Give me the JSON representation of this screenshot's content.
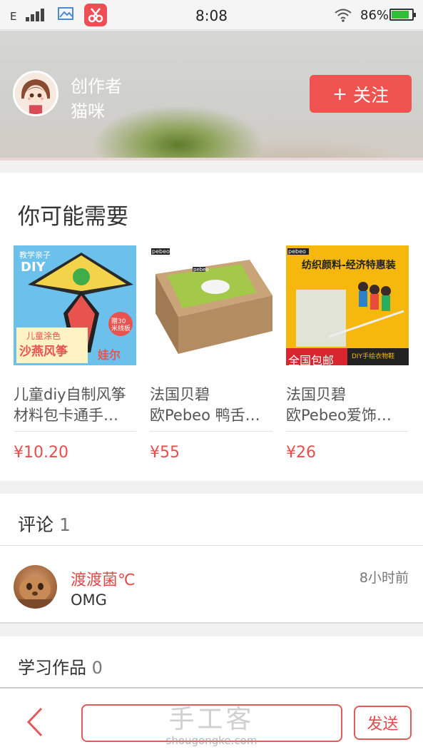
{
  "status_bar": {
    "network": "E",
    "time": "8:08",
    "battery": "86%",
    "battery_level": 0.86
  },
  "creator": {
    "label": "创作者",
    "name": "猫咪",
    "follow_label": "关注",
    "follow_icon": "+"
  },
  "recommend": {
    "title": "你可能需要",
    "products": [
      {
        "line1": "儿童diy自制风筝",
        "line2": "材料包卡通手…",
        "price": "¥10.20",
        "img_text": [
          "教学亲子",
          "DIY",
          "儿童涂色",
          "沙燕风筝",
          "娃尔",
          "赠30米线板"
        ]
      },
      {
        "line1": "法国贝碧",
        "line2": "欧Pebeo 鸭舌…",
        "price": "¥55",
        "img_text": [
          "pebeo",
          "pebeo"
        ]
      },
      {
        "line1": "法国贝碧",
        "line2": "欧Pebeo爱饰…",
        "price": "¥26",
        "img_text": [
          "pebeo",
          "纺织颜料-经济特惠装",
          "全国包邮",
          "DIY手绘衣物鞋"
        ]
      }
    ]
  },
  "comments": {
    "title": "评论",
    "count": "1",
    "items": [
      {
        "user": "渡渡菌℃",
        "time": "8小时前",
        "text": "OMG"
      }
    ]
  },
  "works": {
    "title": "学习作品",
    "count": "0"
  },
  "bottom_bar": {
    "input_placeholder": "",
    "send_label": "发送",
    "watermark_cn": "手工客",
    "watermark_en": "shougongke.com"
  },
  "colors": {
    "accent": "#ef5350",
    "price": "#e84d4d"
  }
}
